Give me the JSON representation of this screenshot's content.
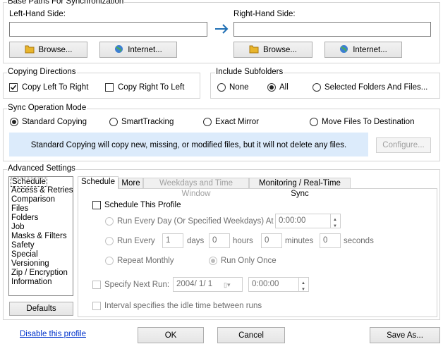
{
  "base_paths": {
    "group_label": "Base Paths For Synchronization",
    "left_label": "Left-Hand Side:",
    "right_label": "Right-Hand Side:",
    "left_value": "",
    "right_value": "",
    "browse_label": "Browse...",
    "internet_label": "Internet..."
  },
  "copying_directions": {
    "group_label": "Copying Directions",
    "left_to_right": "Copy Left To Right",
    "right_to_left": "Copy Right To Left"
  },
  "include_subfolders": {
    "group_label": "Include Subfolders",
    "none": "None",
    "all": "All",
    "selected": "Selected Folders And Files..."
  },
  "sync_mode": {
    "group_label": "Sync Operation Mode",
    "options": [
      "Standard Copying",
      "SmartTracking",
      "Exact Mirror",
      "Move Files To Destination"
    ],
    "description": "Standard Copying will copy new, missing, or modified files, but it will not delete any files.",
    "configure_label": "Configure..."
  },
  "advanced": {
    "group_label": "Advanced Settings",
    "categories": [
      "Schedule",
      "Access & Retries",
      "Comparison",
      "Files",
      "Folders",
      "Job",
      "Masks & Filters",
      "Safety",
      "Special",
      "Versioning",
      "Zip / Encryption",
      "Information"
    ],
    "defaults_label": "Defaults",
    "tabs": [
      "Schedule",
      "More",
      "Weekdays and Time Window",
      "Monitoring / Real-Time Sync"
    ],
    "schedule": {
      "schedule_profile": "Schedule This Profile",
      "run_every_day": "Run Every Day (Or Specified Weekdays) At",
      "run_every_day_time": "0:00:00",
      "run_every": "Run Every",
      "days_value": "1",
      "days_label": "days",
      "hours_value": "0",
      "hours_label": "hours",
      "minutes_value": "0",
      "minutes_label": "minutes",
      "seconds_value": "0",
      "seconds_label": "seconds",
      "repeat_monthly": "Repeat Monthly",
      "run_only_once": "Run Only Once",
      "specify_next_run": "Specify Next Run:",
      "next_run_date": "2004/  1/  1",
      "next_run_time": "0:00:00",
      "interval_idle": "Interval specifies the idle time between runs"
    }
  },
  "footer": {
    "disable_link": "Disable this profile",
    "ok_label": "OK",
    "cancel_label": "Cancel",
    "save_as_label": "Save As..."
  },
  "colors": {
    "info_bg": "#dcebfb",
    "arrow": "#1f6fb4",
    "link": "#0033cc"
  }
}
